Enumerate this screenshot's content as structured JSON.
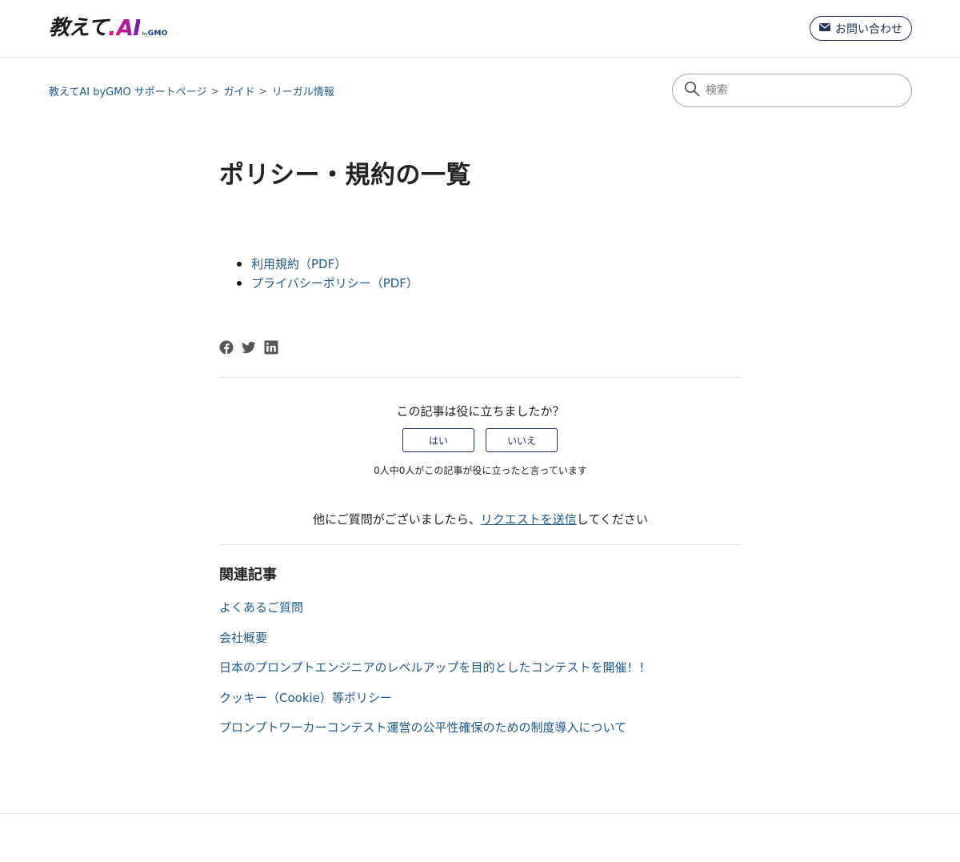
{
  "header": {
    "logo_jp": "教えて",
    "logo_ai": "AI",
    "logo_by": "by",
    "logo_gmo": "GMO",
    "contact_label": "お問い合わせ"
  },
  "breadcrumb": [
    {
      "label": "教えてAI byGMO サポートページ"
    },
    {
      "label": "ガイド"
    },
    {
      "label": "リーガル情報"
    }
  ],
  "breadcrumb_sep": ">",
  "search": {
    "placeholder": "検索"
  },
  "article": {
    "title": "ポリシー・規約の一覧",
    "documents": [
      "利用規約（PDF）",
      "プライバシーポリシー（PDF）"
    ]
  },
  "share": [
    "facebook-icon",
    "twitter-icon",
    "linkedin-icon"
  ],
  "vote": {
    "question": "この記事は役に立ちましたか？",
    "yes_label": "はい",
    "no_label": "いいえ",
    "count_text": "0人中0人がこの記事が役に立ったと言っています"
  },
  "more_questions": {
    "prefix": "他にご質問がございましたら、",
    "link": "リクエストを送信",
    "suffix": "してください"
  },
  "related": {
    "title": "関連記事",
    "items": [
      "よくあるご質問",
      "会社概要",
      "日本のプロンプトエンジニアのレベルアップを目的としたコンテストを開催！！",
      "クッキー（Cookie）等ポリシー",
      "プロンプトワーカーコンテスト運営の公平性確保のための制度導入について"
    ]
  },
  "colors": {
    "link": "#1f5a8c",
    "accent_navy": "#22305a",
    "logo_pink": "#e0168a",
    "logo_purple": "#6b1fb0"
  }
}
